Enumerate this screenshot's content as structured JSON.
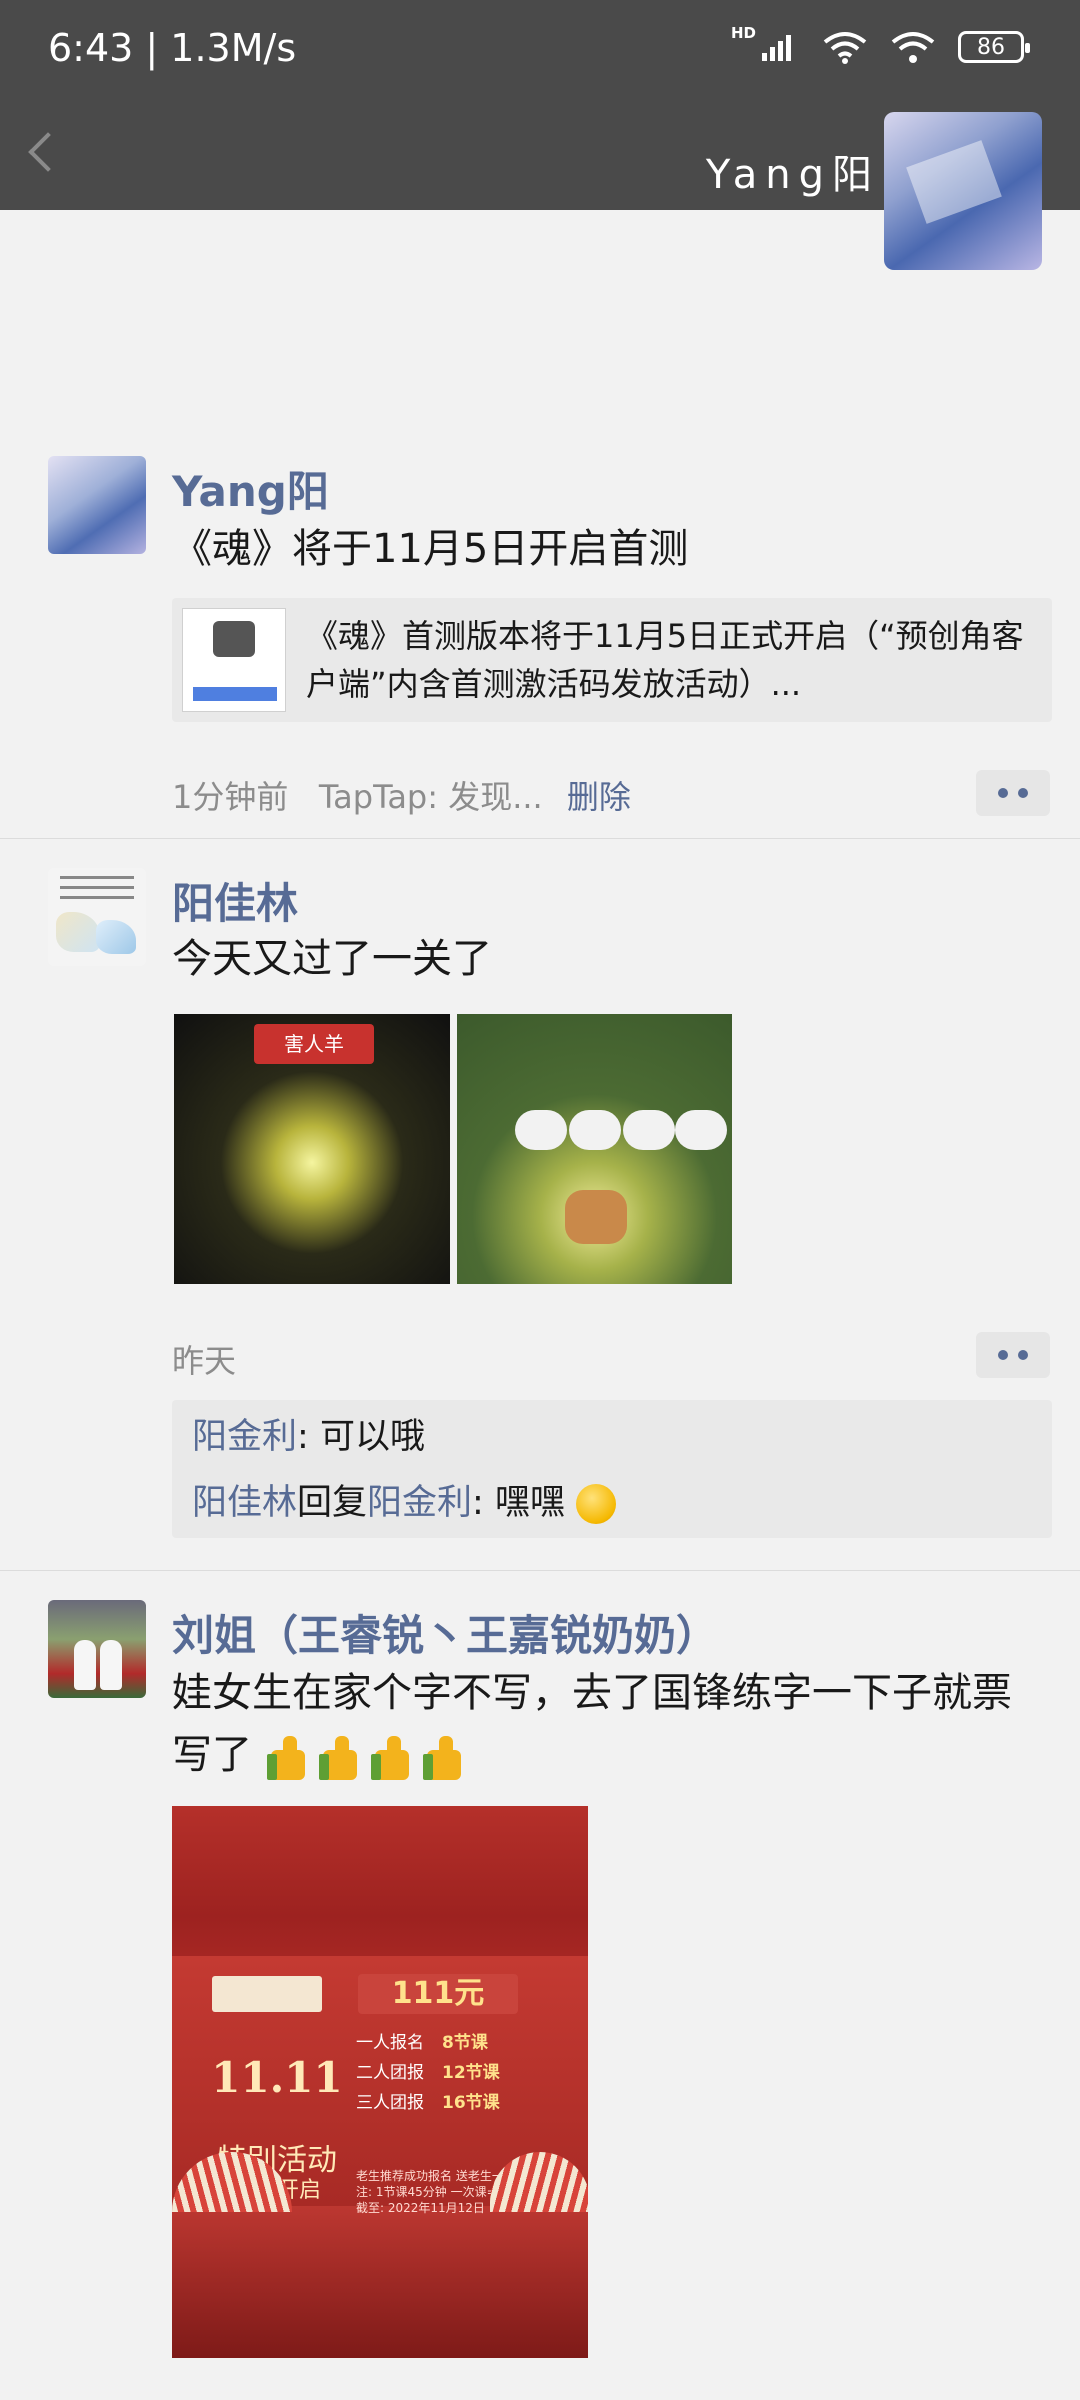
{
  "status_bar": {
    "time_speed": "6:43 | 1.3M/s",
    "network": "HD",
    "battery": "86"
  },
  "header": {
    "title": "Yang阳"
  },
  "posts": [
    {
      "author": "Yang阳",
      "text": "《魂》将于11月5日开启首测",
      "link": {
        "text": "《魂》首测版本将于11月5日正式开启（“预创角客户端”内含首测激活码发放活动）..."
      },
      "time": "1分钟前",
      "source": "TapTap: 发现...",
      "delete_label": "删除"
    },
    {
      "author": "阳佳林",
      "text": "今天又过了一关了",
      "image1_banner": "害人羊",
      "time": "昨天",
      "comments": [
        {
          "from": "阳金利",
          "sep": ": ",
          "text": "可以哦"
        },
        {
          "from": "阳佳林",
          "reply_word": "回复",
          "to": "阳金利",
          "sep": ": ",
          "text": "嘿嘿"
        }
      ]
    },
    {
      "author": "刘姐（王睿锐丶王嘉锐奶奶）",
      "text": "娃女生在家个字不写，去了国锋练字一下子就票写了",
      "poster": {
        "price": "111元",
        "big": "11.11",
        "headline": "特别活动",
        "sub": "预售开启",
        "row1": "一人报名",
        "row1_val": "8节课",
        "row2": "二人团报",
        "row2_val": "12节课",
        "row3": "三人团报",
        "row3_val": "16节课",
        "note": "老生推荐成功报名 送老生一次课",
        "footnote": "注: 1节课45分钟 一次课=2节课 活动截至: 2022年11月12日"
      }
    }
  ]
}
